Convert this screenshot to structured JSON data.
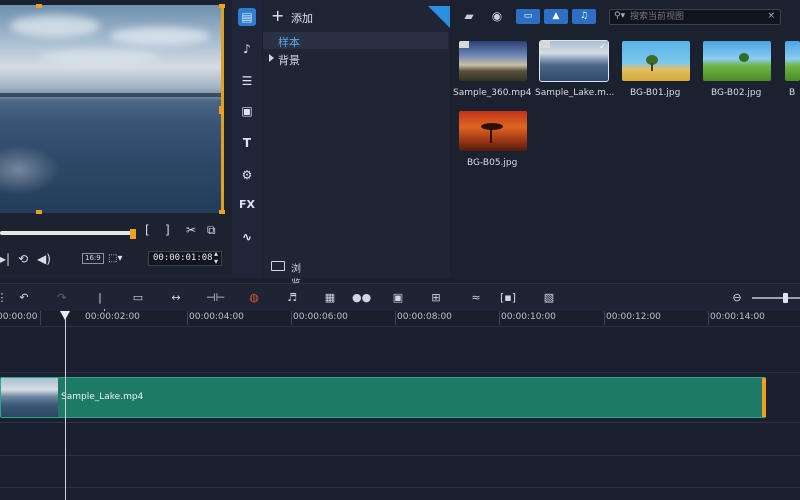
{
  "library_tree": {
    "add_label": "添加",
    "items": [
      {
        "label": "样本"
      },
      {
        "label": "背景"
      }
    ],
    "browse_label": "浏览"
  },
  "categories": [
    {
      "icon": "media-icon"
    },
    {
      "icon": "instant-project-icon"
    },
    {
      "icon": "title-template-icon"
    },
    {
      "icon": "subtitle-icon"
    },
    {
      "icon": "title-icon",
      "label": "T"
    },
    {
      "icon": "transition-icon"
    },
    {
      "icon": "fx-icon",
      "label": "FX"
    },
    {
      "icon": "path-icon"
    }
  ],
  "preview": {
    "timecode": "00:00:01:08",
    "aspect_ratio": "16:9",
    "mark_in": "[",
    "mark_out": "]"
  },
  "library": {
    "search_placeholder": "搜索当前视图",
    "items": [
      {
        "label": "Sample_360.mp4",
        "type": "video"
      },
      {
        "label": "Sample_Lake.m...",
        "type": "video",
        "checked": true
      },
      {
        "label": "BG-B01.jpg",
        "type": "image"
      },
      {
        "label": "BG-B02.jpg",
        "type": "image"
      },
      {
        "label": "BG-B05.jpg",
        "type": "image"
      }
    ]
  },
  "timeline": {
    "ruler_labels": [
      "00:00:00",
      "00:00:02:00",
      "00:00:04:00",
      "00:00:06:00",
      "00:00:08:00",
      "00:00:10:00",
      "00:00:12:00",
      "00:00:14:00"
    ],
    "clip": {
      "label": "Sample_Lake.mp4"
    }
  },
  "colors": {
    "accent": "#2d7fd6",
    "clip": "#1d7a66",
    "handle": "#f0a020"
  }
}
